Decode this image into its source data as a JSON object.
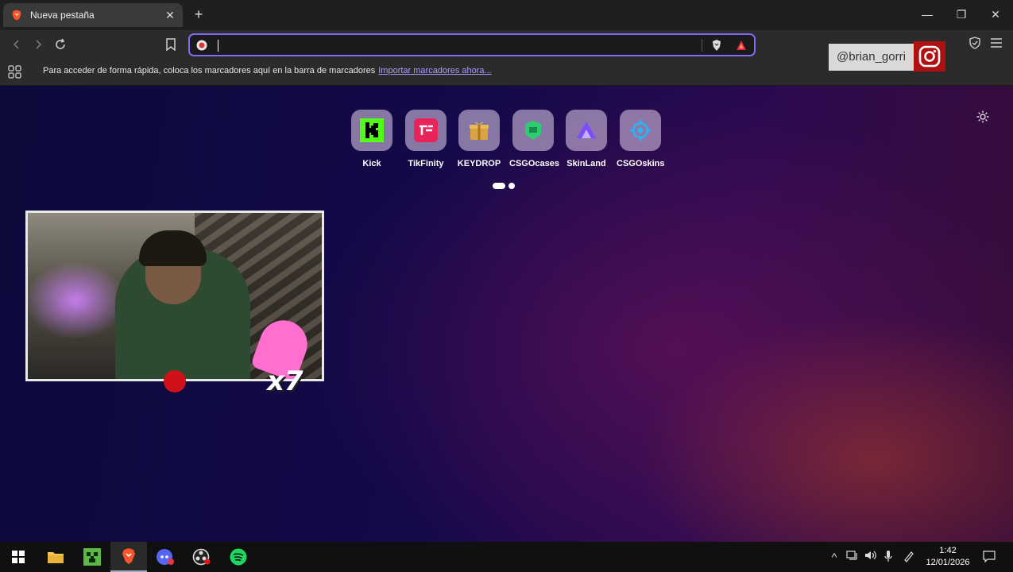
{
  "browser": {
    "tab": {
      "title": "Nueva pestaña",
      "close": "✕"
    },
    "new_tab": "+",
    "window_controls": {
      "minimize": "—",
      "restore": "❐",
      "close": "✕"
    },
    "address_bar": {
      "value": "",
      "placeholder": ""
    },
    "bookmarks_bar": {
      "hint": "Para acceder de forma rápida, coloca los marcadores aquí en la barra de marcadores",
      "import_link": "Importar marcadores ahora..."
    },
    "accent": "#7c6ef5"
  },
  "overlay": {
    "instagram_handle": "@brian_gorri"
  },
  "new_tab_page": {
    "top_sites": [
      {
        "label": "Kick",
        "icon": "kick-icon",
        "color": "#53fc18"
      },
      {
        "label": "TikFinity",
        "icon": "tikfinity-icon",
        "color": "#e8245a"
      },
      {
        "label": "KEYDROP",
        "icon": "keydrop-icon",
        "color": "#d9a441"
      },
      {
        "label": "CSGOcases",
        "icon": "csgocases-icon",
        "color": "#2ecc71"
      },
      {
        "label": "SkinLand",
        "icon": "skinland-icon",
        "color": "#7c4dff"
      },
      {
        "label": "CSGOskins",
        "icon": "csgoskins-icon",
        "color": "#29b6f6"
      }
    ],
    "page_indicator": {
      "pages": 2,
      "current": 1
    }
  },
  "webcam": {
    "badge": "x7"
  },
  "taskbar": {
    "apps": [
      {
        "name": "file-explorer",
        "icon": "folder-icon",
        "active": false
      },
      {
        "name": "minecraft",
        "icon": "minecraft-icon",
        "active": false
      },
      {
        "name": "brave",
        "icon": "brave-icon",
        "active": true
      },
      {
        "name": "discord",
        "icon": "discord-icon",
        "active": false
      },
      {
        "name": "obs",
        "icon": "obs-icon",
        "active": false
      },
      {
        "name": "spotify",
        "icon": "spotify-icon",
        "active": false
      }
    ],
    "clock": {
      "time": "1:42",
      "date": "12/01/2026"
    }
  }
}
